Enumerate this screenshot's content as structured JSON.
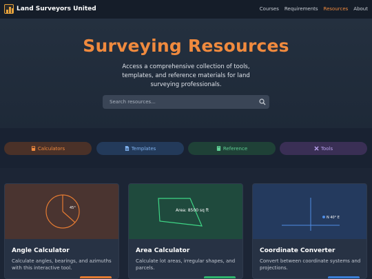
{
  "nav": {
    "brand": "Land Surveyors United",
    "links": [
      {
        "label": "Courses",
        "active": false
      },
      {
        "label": "Requirements",
        "active": false
      },
      {
        "label": "Resources",
        "active": true
      },
      {
        "label": "About",
        "active": false
      }
    ]
  },
  "hero": {
    "title": "Surveying Resources",
    "subtitle": "Access a comprehensive collection of tools, templates, and reference materials for land surveying professionals.",
    "search_placeholder": "Search resources..."
  },
  "filters": [
    {
      "label": "Calculators",
      "icon": "calculator-icon"
    },
    {
      "label": "Templates",
      "icon": "file-icon"
    },
    {
      "label": "Reference",
      "icon": "book-icon"
    },
    {
      "label": "Tools",
      "icon": "tools-icon"
    }
  ],
  "cards": [
    {
      "title": "Angle Calculator",
      "description": "Calculate angles, bearings, and azimuths with this interactive tool.",
      "art_label": "45°"
    },
    {
      "title": "Area Calculator",
      "description": "Calculate lot areas, irregular shapes, and parcels.",
      "art_label": "Area: 8500 sq ft"
    },
    {
      "title": "Coordinate Converter",
      "description": "Convert between coordinate systems and projections.",
      "art_label": "N 40° E"
    }
  ],
  "colors": {
    "accent": "#f08a3e",
    "calculators": "#f08a3e",
    "templates": "#7fb1ee",
    "reference": "#5fcf95",
    "tools": "#b9a3ef"
  }
}
